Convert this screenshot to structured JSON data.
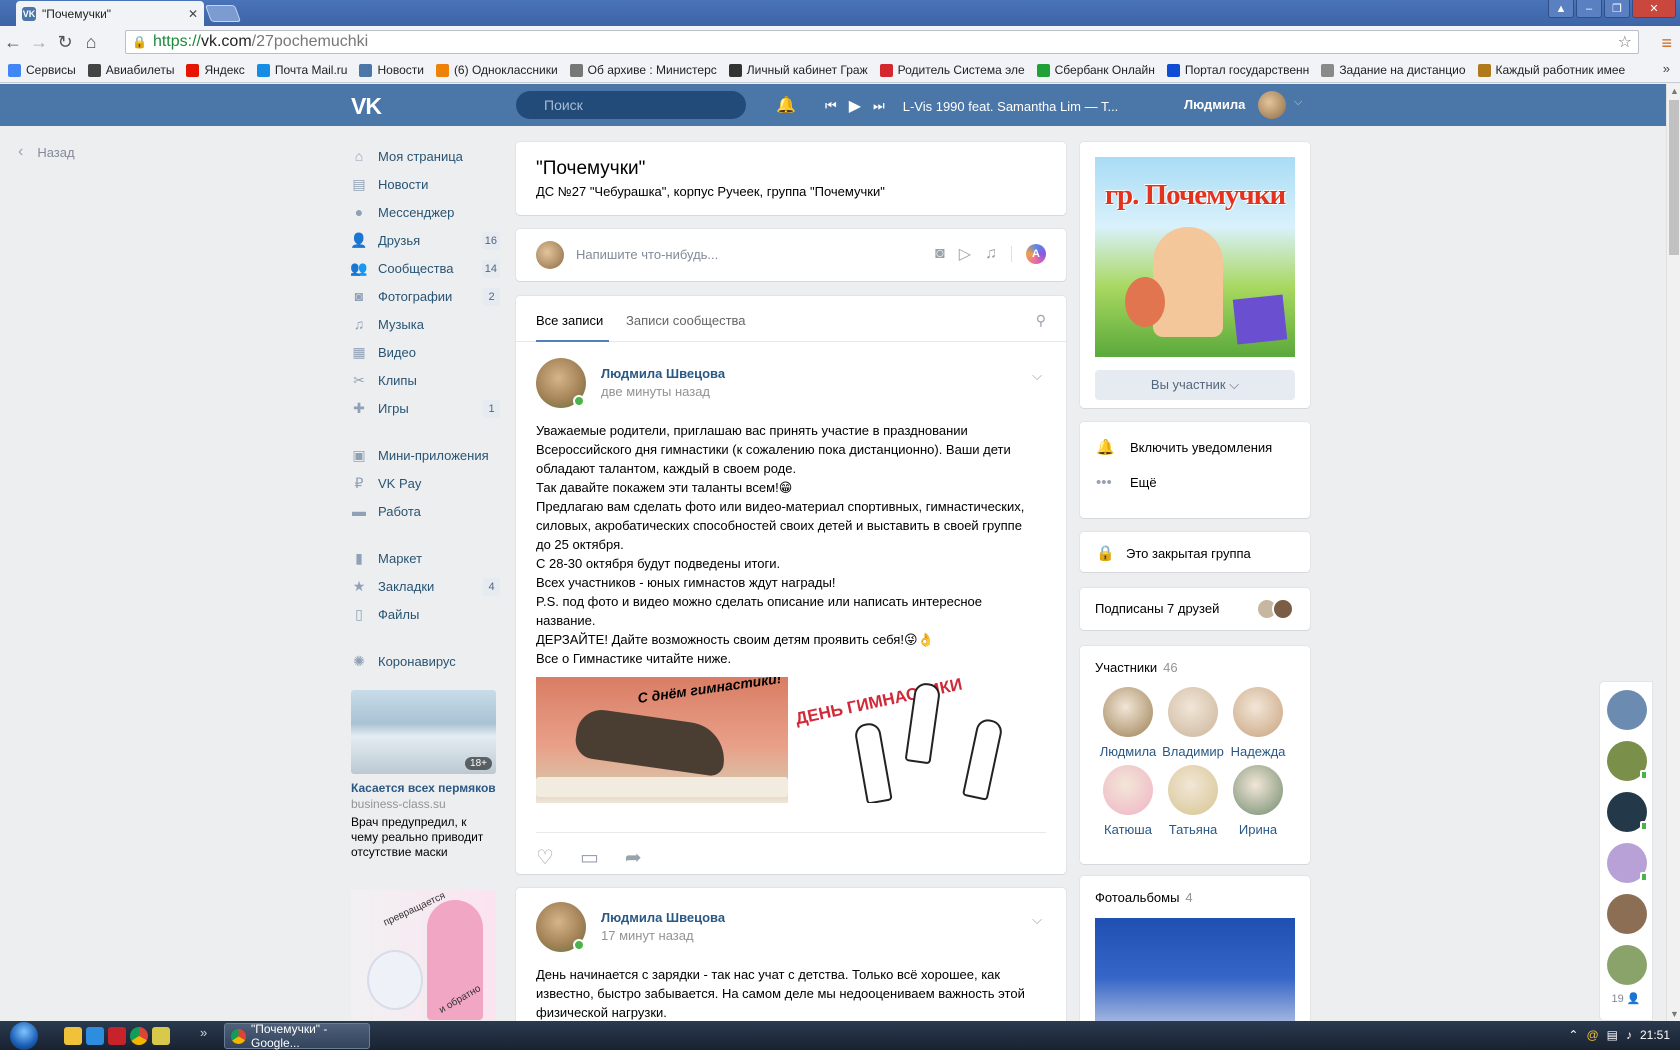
{
  "browser": {
    "tab_title": "\"Почемучки\"",
    "url_protocol": "https://",
    "url_host": "vk.com",
    "url_path": "/27pochemuchki",
    "bookmarks": [
      {
        "label": "Сервисы",
        "color": "#4285f4"
      },
      {
        "label": "Авиабилеты",
        "color": "#444444"
      },
      {
        "label": "Яндекс",
        "color": "#e61400"
      },
      {
        "label": "Почта Mail.ru",
        "color": "#168de2"
      },
      {
        "label": "Новости",
        "color": "#4a76a8"
      },
      {
        "label": "(6) Одноклассники",
        "color": "#ee8208"
      },
      {
        "label": "Об архиве : Министерс",
        "color": "#777777"
      },
      {
        "label": "Личный кабинет Граж",
        "color": "#333333"
      },
      {
        "label": "Родитель Система эле",
        "color": "#d3282f"
      },
      {
        "label": "Сбербанк Онлайн",
        "color": "#21a038"
      },
      {
        "label": "Портал государственн",
        "color": "#0d4cd3"
      },
      {
        "label": "Задание на дистанцио",
        "color": "#8a8a8a"
      },
      {
        "label": "Каждый работник имее",
        "color": "#b07a1a"
      }
    ]
  },
  "header": {
    "search_placeholder": "Поиск",
    "track": "L-Vis 1990 feat. Samantha Lim — T...",
    "user_name": "Людмила"
  },
  "back_label": "Назад",
  "nav": {
    "group1": [
      {
        "label": "Моя страница",
        "icon": "home-icon",
        "glyph": "⌂",
        "count": ""
      },
      {
        "label": "Новости",
        "icon": "news-icon",
        "glyph": "▤",
        "count": ""
      },
      {
        "label": "Мессенджер",
        "icon": "messenger-icon",
        "glyph": "●",
        "count": ""
      },
      {
        "label": "Друзья",
        "icon": "friends-icon",
        "glyph": "👤",
        "count": "16"
      },
      {
        "label": "Сообщества",
        "icon": "communities-icon",
        "glyph": "👥",
        "count": "14"
      },
      {
        "label": "Фотографии",
        "icon": "photos-icon",
        "glyph": "◙",
        "count": "2"
      },
      {
        "label": "Музыка",
        "icon": "music-icon",
        "glyph": "♫",
        "count": ""
      },
      {
        "label": "Видео",
        "icon": "video-icon",
        "glyph": "▦",
        "count": ""
      },
      {
        "label": "Клипы",
        "icon": "clips-icon",
        "glyph": "✂",
        "count": ""
      },
      {
        "label": "Игры",
        "icon": "games-icon",
        "glyph": "✚",
        "count": "1"
      }
    ],
    "group2": [
      {
        "label": "Мини-приложения",
        "icon": "mini-apps-icon",
        "glyph": "▣",
        "count": ""
      },
      {
        "label": "VK Pay",
        "icon": "vkpay-icon",
        "glyph": "₽",
        "count": ""
      },
      {
        "label": "Работа",
        "icon": "work-icon",
        "glyph": "▬",
        "count": ""
      }
    ],
    "group3": [
      {
        "label": "Маркет",
        "icon": "market-icon",
        "glyph": "▮",
        "count": ""
      },
      {
        "label": "Закладки",
        "icon": "bookmarks-icon",
        "glyph": "★",
        "count": "4"
      },
      {
        "label": "Файлы",
        "icon": "files-icon",
        "glyph": "▯",
        "count": ""
      }
    ],
    "group4": [
      {
        "label": "Коронавирус",
        "icon": "coronavirus-icon",
        "glyph": "✺",
        "count": ""
      }
    ]
  },
  "ad1": {
    "badge": "18+",
    "title": "Касается всех пермяков",
    "site": "business-class.su",
    "text": "Врач предупредил, к чему реально приводит отсутствие маски"
  },
  "ad2": {
    "caption_top": "превращается",
    "caption_bottom": "и обратно"
  },
  "group": {
    "title": "\"Почемучки\"",
    "subtitle": "ДС №27 \"Чебурашка\", корпус Ручеек, группа \"Почемучки\"",
    "cover_text": "гр. Почемучки",
    "membership": "Вы участник ⌵"
  },
  "composer": {
    "placeholder": "Напишите что-нибудь..."
  },
  "feed": {
    "tab_all": "Все записи",
    "tab_community": "Записи сообщества"
  },
  "post1": {
    "author": "Людмила Швецова",
    "time": "две минуты назад",
    "lines": [
      "Уважаемые родители, приглашаю вас принять участие в праздновании",
      "Всероссийского дня гимнастики (к сожалению пока дистанционно). Ваши дети",
      "обладают талантом, каждый в своем роде.",
      "Так давайте покажем эти таланты всем!😁",
      "Предлагаю вам сделать фото или видео-материал спортивных, гимнастических,",
      "силовых, акробатических способностей своих детей и выставить в своей группе",
      "до 25 октября.",
      "С 28-30 октября будут подведены итоги.",
      "Всех участников - юных гимнастов ждут награды!",
      "P.S. под фото и видео можно сделать описание или написать интересное",
      "название.",
      "ДЕРЗАЙТЕ! Дайте возможность своим детям проявить себя!😜👌",
      "Все о Гимнастике читайте ниже."
    ],
    "img1_caption": "С днём гимнастики!",
    "img2_caption": "ДЕНЬ ГИМНАСТИКИ"
  },
  "post2": {
    "author": "Людмила Швецова",
    "time": "17 минут назад",
    "lines": [
      "День начинается с зарядки - так нас учат с детства. Только всё хорошее, как",
      "известно, быстро забывается. На самом деле мы недооцениваем важность этой",
      "физической нагрузки."
    ]
  },
  "right": {
    "notify": "Включить уведомления",
    "more": "Ещё",
    "closed": "Это закрытая группа",
    "friends": "Подписаны 7 друзей",
    "members_label": "Участники",
    "members_count": "46",
    "members": [
      {
        "name": "Людмила",
        "color": "#9c7f52"
      },
      {
        "name": "Владимир",
        "color": "#c9b49a"
      },
      {
        "name": "Надежда",
        "color": "#c8a27c"
      },
      {
        "name": "Катюша",
        "color": "#f0b3c4"
      },
      {
        "name": "Татьяна",
        "color": "#d6c58f"
      },
      {
        "name": "Ирина",
        "color": "#6f8a6c"
      }
    ],
    "albums_label": "Фотоальбомы",
    "albums_count": "4"
  },
  "dock": {
    "count": "19 👤"
  },
  "taskbar": {
    "app": "\"Почемучки\" - Google...",
    "time": "21:51"
  }
}
